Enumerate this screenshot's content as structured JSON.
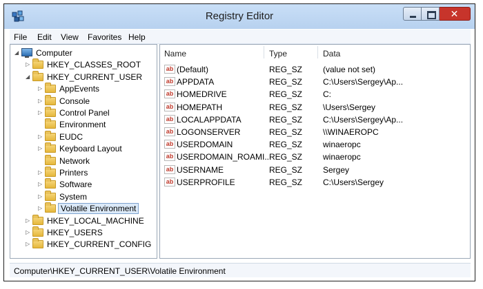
{
  "window": {
    "title": "Registry Editor"
  },
  "menu": [
    "File",
    "Edit",
    "View",
    "Favorites",
    "Help"
  ],
  "tree": [
    {
      "label": "Computer",
      "level": 0,
      "icon": "computer-icon",
      "expander": "expanded"
    },
    {
      "label": "HKEY_CLASSES_ROOT",
      "level": 1,
      "icon": "folder-icon",
      "expander": "collapsed"
    },
    {
      "label": "HKEY_CURRENT_USER",
      "level": 1,
      "icon": "folder-icon",
      "expander": "expanded"
    },
    {
      "label": "AppEvents",
      "level": 2,
      "icon": "folder-icon",
      "expander": "collapsed"
    },
    {
      "label": "Console",
      "level": 2,
      "icon": "folder-icon",
      "expander": "collapsed"
    },
    {
      "label": "Control Panel",
      "level": 2,
      "icon": "folder-icon",
      "expander": "collapsed"
    },
    {
      "label": "Environment",
      "level": 2,
      "icon": "folder-icon",
      "expander": "none"
    },
    {
      "label": "EUDC",
      "level": 2,
      "icon": "folder-icon",
      "expander": "collapsed"
    },
    {
      "label": "Keyboard Layout",
      "level": 2,
      "icon": "folder-icon",
      "expander": "collapsed"
    },
    {
      "label": "Network",
      "level": 2,
      "icon": "folder-icon",
      "expander": "none"
    },
    {
      "label": "Printers",
      "level": 2,
      "icon": "folder-icon",
      "expander": "collapsed"
    },
    {
      "label": "Software",
      "level": 2,
      "icon": "folder-icon",
      "expander": "collapsed"
    },
    {
      "label": "System",
      "level": 2,
      "icon": "folder-icon",
      "expander": "collapsed"
    },
    {
      "label": "Volatile Environment",
      "level": 2,
      "icon": "folder-icon",
      "expander": "collapsed",
      "selected": true
    },
    {
      "label": "HKEY_LOCAL_MACHINE",
      "level": 1,
      "icon": "folder-icon",
      "expander": "collapsed"
    },
    {
      "label": "HKEY_USERS",
      "level": 1,
      "icon": "folder-icon",
      "expander": "collapsed"
    },
    {
      "label": "HKEY_CURRENT_CONFIG",
      "level": 1,
      "icon": "folder-icon",
      "expander": "collapsed"
    }
  ],
  "list": {
    "columns": [
      "Name",
      "Type",
      "Data"
    ],
    "rows": [
      {
        "name": "(Default)",
        "type": "REG_SZ",
        "data": "(value not set)"
      },
      {
        "name": "APPDATA",
        "type": "REG_SZ",
        "data": "C:\\Users\\Sergey\\Ap..."
      },
      {
        "name": "HOMEDRIVE",
        "type": "REG_SZ",
        "data": "C:"
      },
      {
        "name": "HOMEPATH",
        "type": "REG_SZ",
        "data": "\\Users\\Sergey"
      },
      {
        "name": "LOCALAPPDATA",
        "type": "REG_SZ",
        "data": "C:\\Users\\Sergey\\Ap..."
      },
      {
        "name": "LOGONSERVER",
        "type": "REG_SZ",
        "data": "\\\\WINAEROPC"
      },
      {
        "name": "USERDOMAIN",
        "type": "REG_SZ",
        "data": "winaeropc"
      },
      {
        "name": "USERDOMAIN_ROAMI...",
        "type": "REG_SZ",
        "data": "winaeropc"
      },
      {
        "name": "USERNAME",
        "type": "REG_SZ",
        "data": "Sergey"
      },
      {
        "name": "USERPROFILE",
        "type": "REG_SZ",
        "data": "C:\\Users\\Sergey"
      }
    ],
    "value_icon_text": "ab"
  },
  "status": {
    "path": "Computer\\HKEY_CURRENT_USER\\Volatile Environment"
  },
  "colors": {
    "titlebar": "#b7d1ef",
    "close_button": "#c7342b",
    "selection": "#dbe9f8"
  }
}
